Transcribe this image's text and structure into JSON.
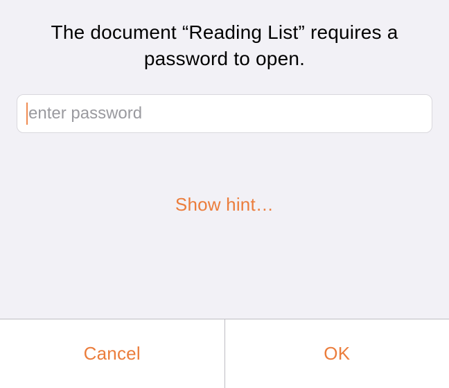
{
  "dialog": {
    "title": "The document “Reading List” requires a password to open.",
    "password_placeholder": "enter password",
    "password_value": "",
    "show_hint_label": "Show hint…"
  },
  "buttons": {
    "cancel": "Cancel",
    "ok": "OK"
  },
  "colors": {
    "accent": "#eb7d3c",
    "background": "#f2f1f6",
    "divider": "#bdbcc2"
  }
}
